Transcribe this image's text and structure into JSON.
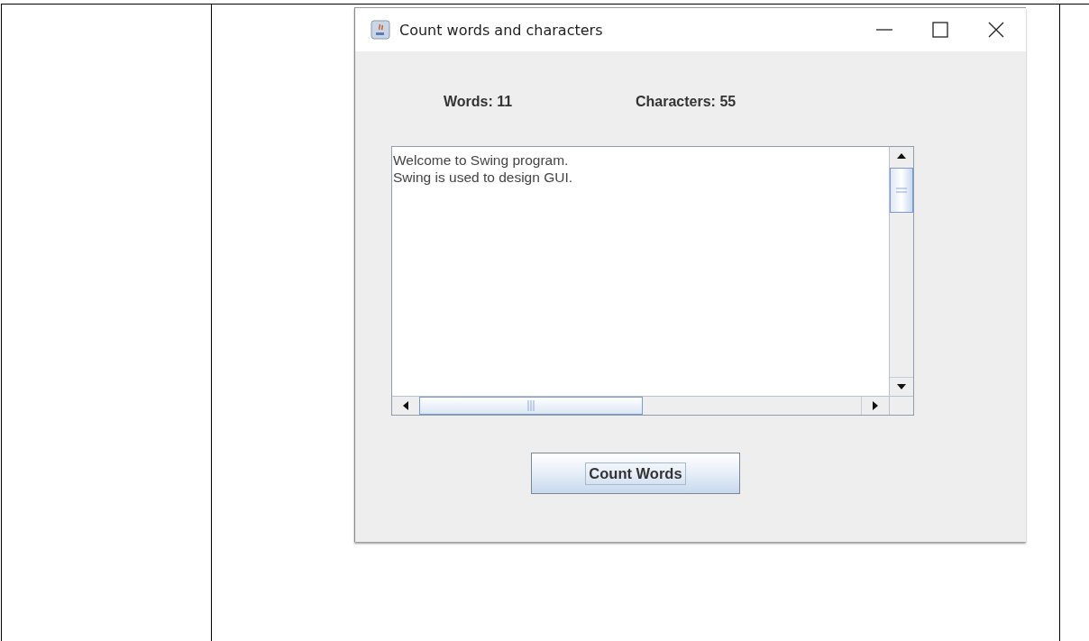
{
  "window": {
    "title": "Count words and characters"
  },
  "counts": [
    {
      "label": "Words: 11"
    },
    {
      "label": "Characters: 55"
    }
  ],
  "text_area": {
    "lines": [
      "Welcome to Swing program.",
      "Swing is used to design GUI."
    ]
  },
  "button": {
    "label": "Count Words",
    "focused": true
  }
}
